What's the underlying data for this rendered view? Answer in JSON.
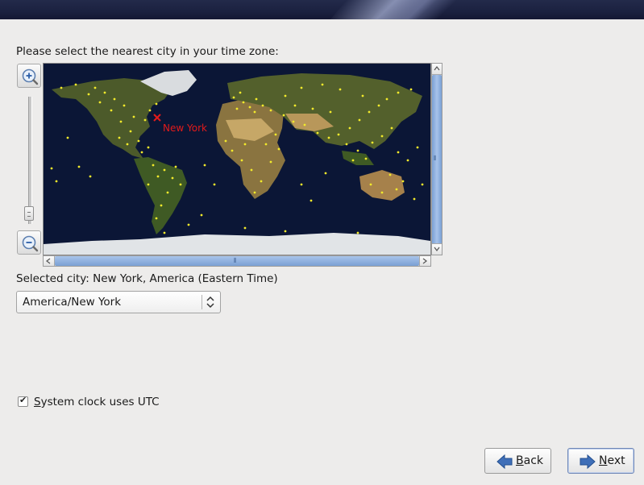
{
  "prompt": "Please select the nearest city in your time zone:",
  "map": {
    "marker_label": "New York",
    "marker_symbol": "x",
    "ocean_color": "#0b1636",
    "city_dot_color": "#f2ea2b",
    "marker_color": "#e21b1b"
  },
  "zoom": {
    "in_icon": "zoom-in-icon",
    "out_icon": "zoom-out-icon"
  },
  "selected_city_text": "Selected city: New York, America (Eastern Time)",
  "timezone_combo": {
    "value": "America/New York"
  },
  "utc_checkbox": {
    "label": "System clock uses UTC",
    "checked": true,
    "check_mark": "✔"
  },
  "buttons": {
    "back": "Back",
    "next": "Next"
  },
  "scroll_grip": "⦀"
}
